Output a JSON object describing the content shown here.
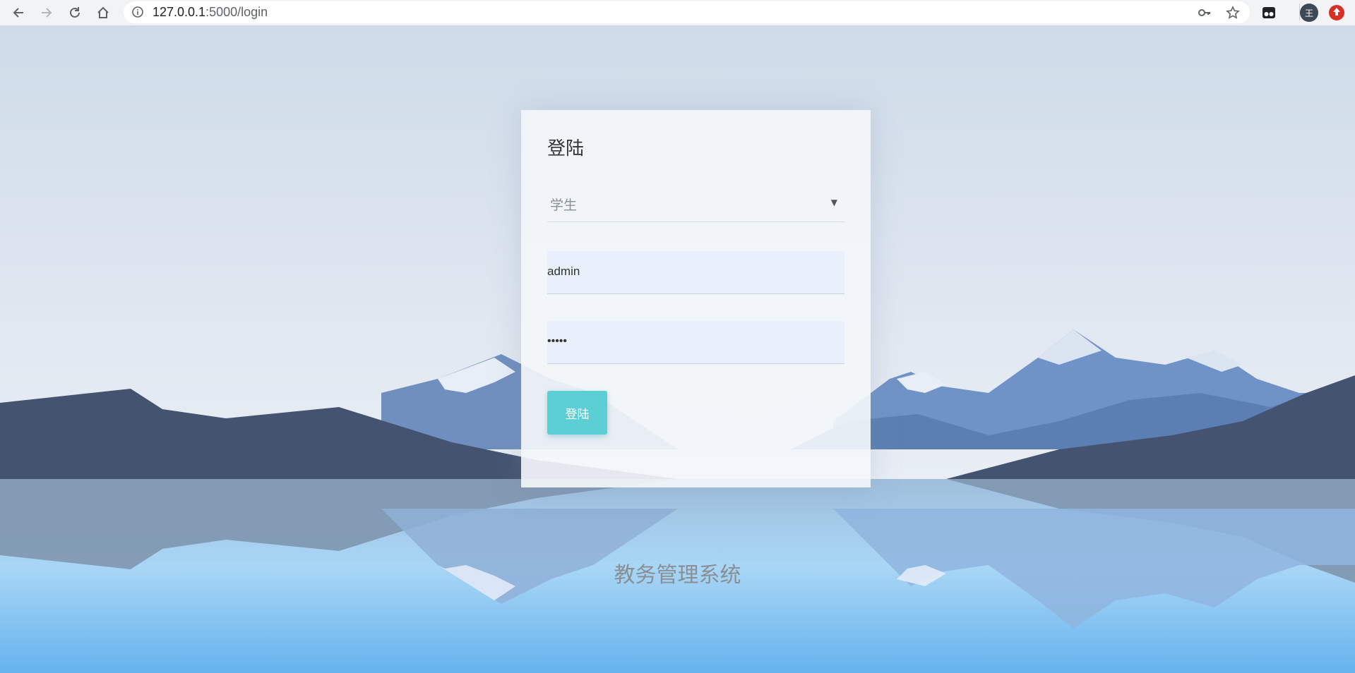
{
  "browser": {
    "url_host": "127.0.0.1",
    "url_path": ":5000/login",
    "profile_initial": "王"
  },
  "login": {
    "title": "登陆",
    "role_selected": "学生",
    "username_value": "admin",
    "password_mask": "•••••",
    "submit_label": "登陆"
  },
  "footer": {
    "system_name": "教务管理系统"
  },
  "colors": {
    "accent": "#5ccfd5",
    "input_bg": "#e8f0fb"
  },
  "icons": [
    "back-arrow-icon",
    "forward-arrow-icon",
    "reload-icon",
    "home-icon",
    "info-icon",
    "key-icon",
    "star-icon",
    "extension-icon",
    "profile-avatar",
    "alert-extension-icon"
  ]
}
